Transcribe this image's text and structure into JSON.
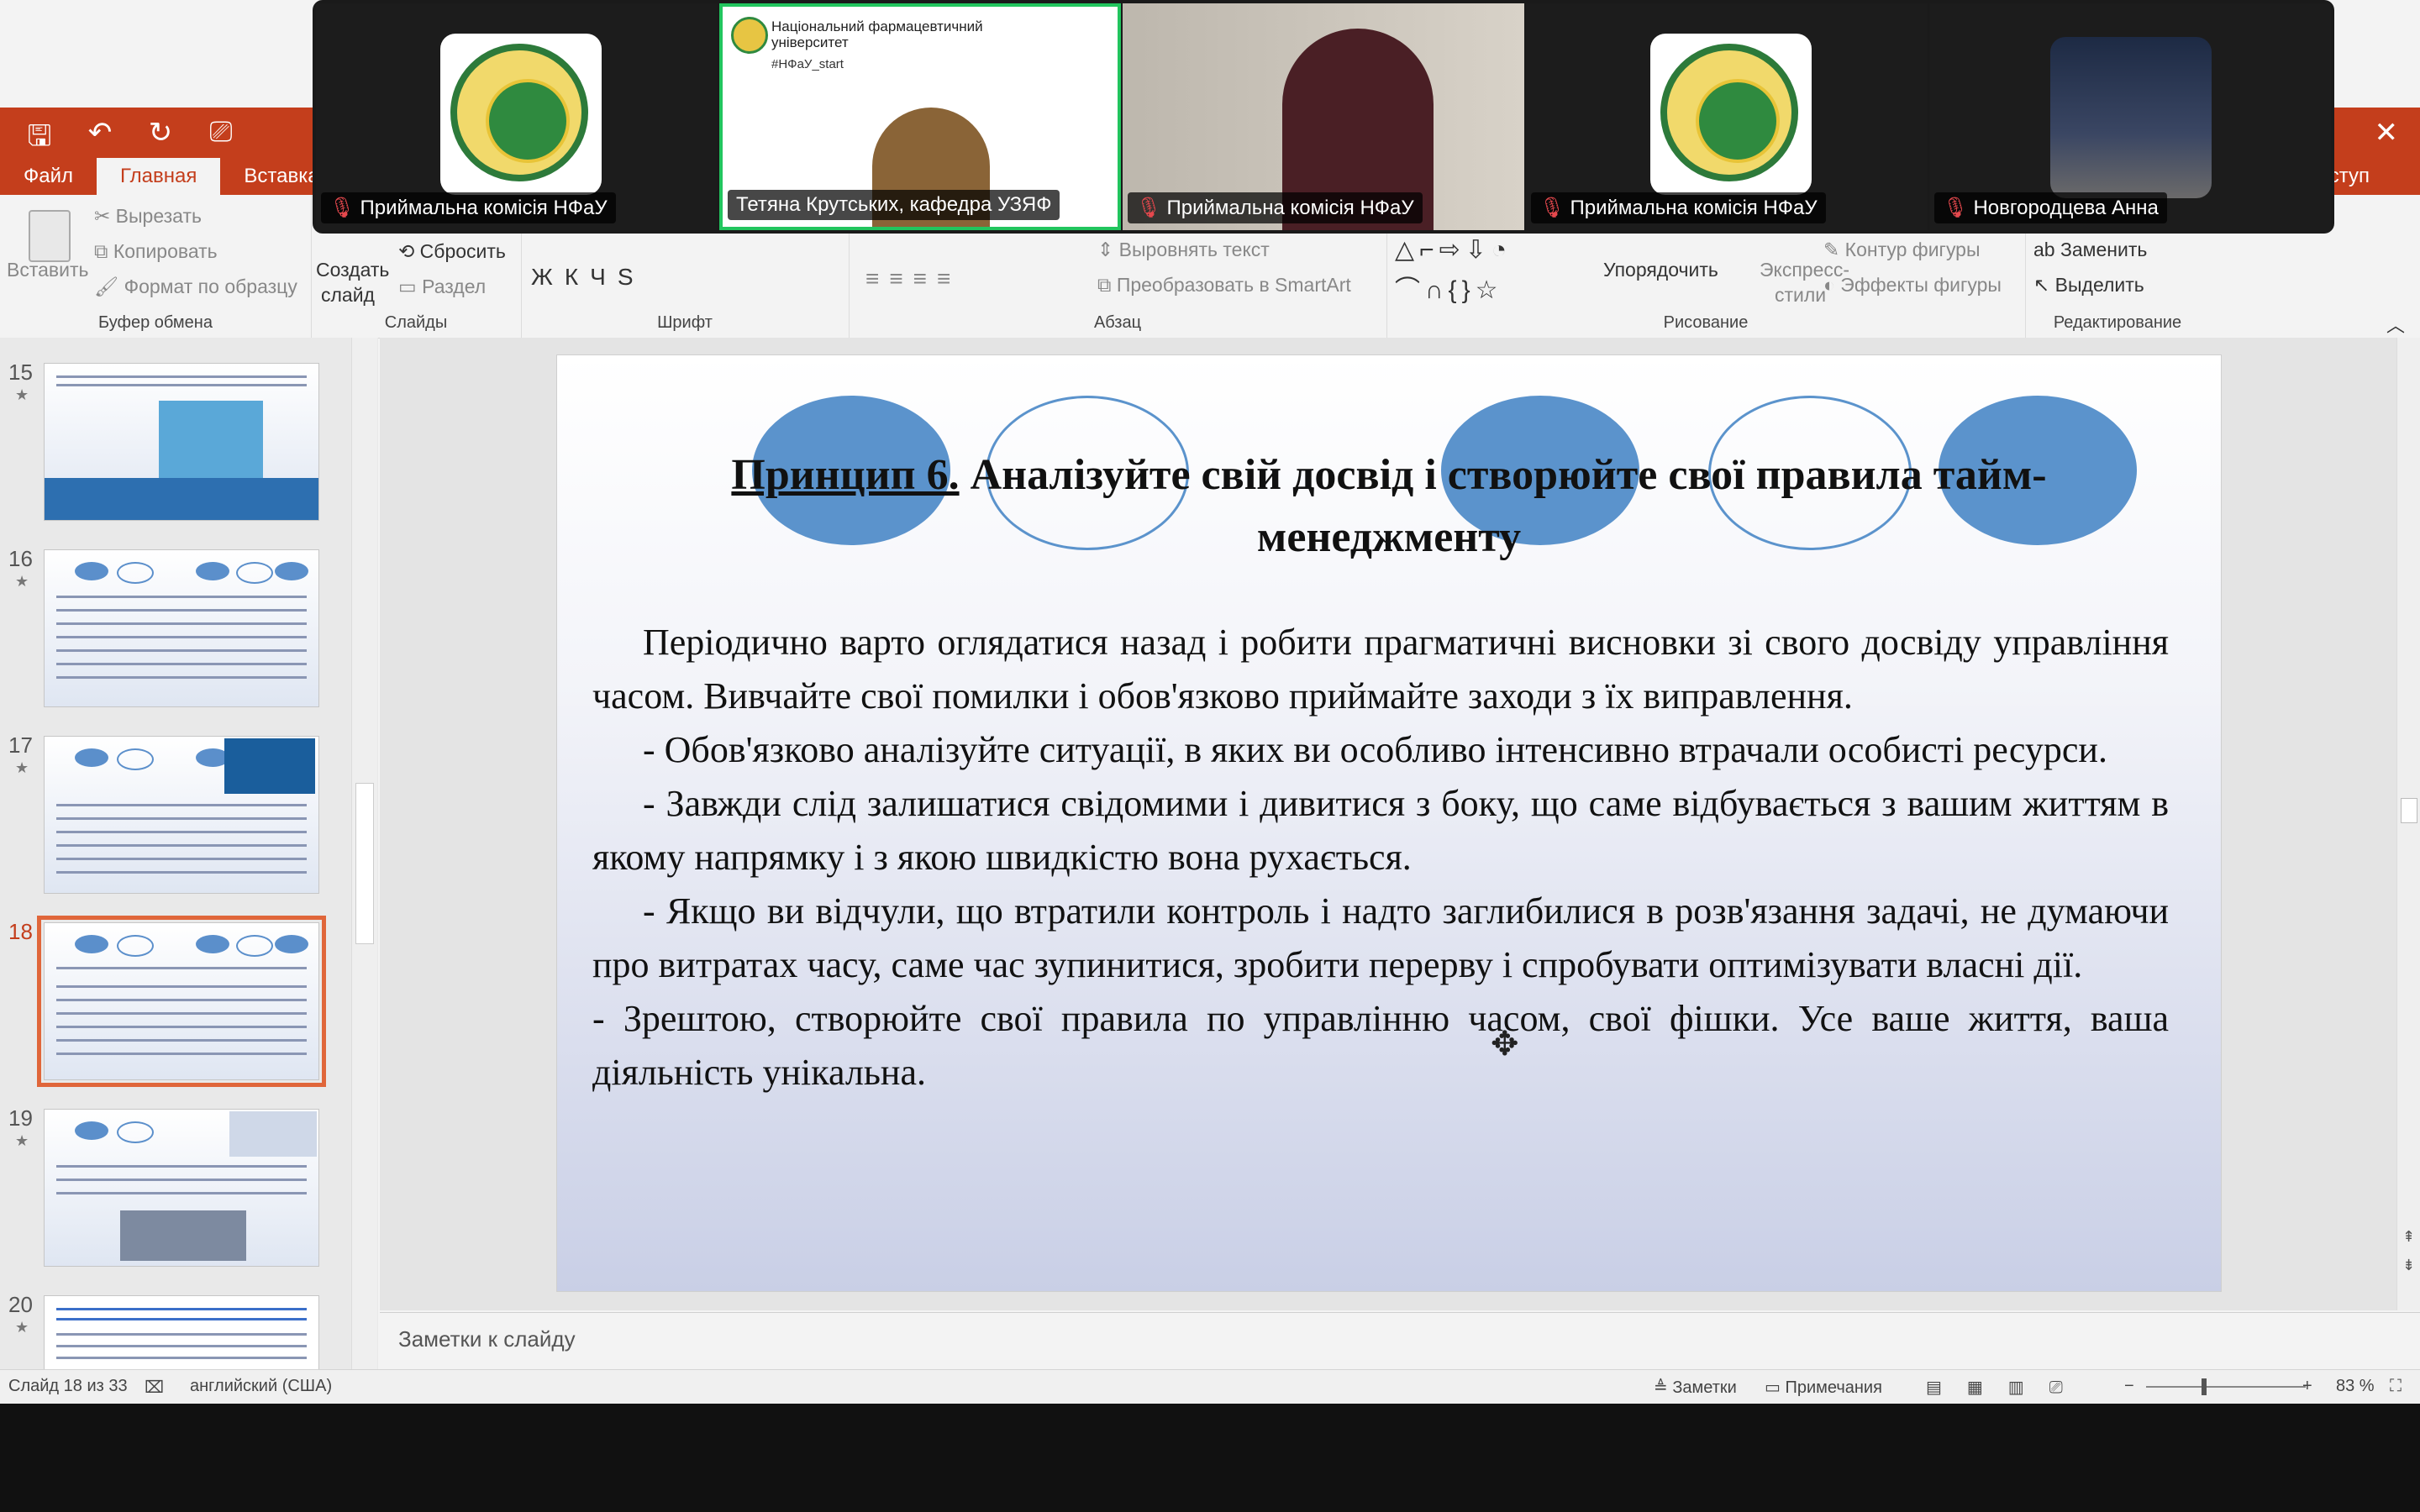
{
  "ribbon": {
    "tabs": [
      "Файл",
      "Главная",
      "Вставка"
    ],
    "active_tab": "Главная",
    "share_label": "доступ",
    "clipboard": {
      "paste": "Вставить",
      "cut": "Вырезать",
      "copy": "Копировать",
      "format_painter": "Формат по образцу",
      "group_label": "Буфер обмена"
    },
    "slides": {
      "new_slide": "Создать",
      "new_slide_2": "слайд",
      "reset": "Сбросить",
      "section": "Раздел",
      "group_label": "Слайды"
    },
    "font": {
      "group_label": "Шрифт"
    },
    "paragraph": {
      "align_text": "Выровнять текст",
      "convert_smartart": "Преобразовать в SmartArt",
      "group_label": "Абзац"
    },
    "drawing": {
      "arrange": "Упорядочить",
      "quick_styles": "Экспресс-",
      "quick_styles_2": "стили",
      "shape_outline": "Контур фигуры",
      "shape_effects": "Эффекты фигуры",
      "group_label": "Рисование"
    },
    "editing": {
      "replace": "Заменить",
      "select": "Выделить",
      "group_label": "Редактирование"
    }
  },
  "thumbnails": [
    {
      "num": "15"
    },
    {
      "num": "16"
    },
    {
      "num": "17"
    },
    {
      "num": "18"
    },
    {
      "num": "19"
    },
    {
      "num": "20"
    }
  ],
  "slide": {
    "title_underlined": "Принцип 6.",
    "title_rest": " Аналізуйте свій досвід і створюйте свої правила тайм-менеджменту",
    "paragraphs": [
      "Періодично варто оглядатися назад і робити прагматичні висновки зі свого досвіду управління часом. Вивчайте свої помилки і обов'язково приймайте заходи з їх виправлення.",
      "- Обов'язково аналізуйте ситуації, в яких ви особливо інтенсивно втрачали особисті ресурси.",
      "- Завжди слід залишатися свідомими і дивитися з боку, що саме відбувається з вашим життям   в якому напрямку і з якою швидкістю вона рухається.",
      "- Якщо ви відчули, що втратили контроль і надто заглибилися в розв'язання задачі, не думаючи про витратах часу, саме час зупинитися, зробити перерву і спробувати оптимізувати власні дії.",
      "-   Зрештою, створюйте свої правила по управлінню часом, свої фішки. Усе ваше життя, ваша діяльність унікальна."
    ]
  },
  "notes_placeholder": "Заметки к слайду",
  "status": {
    "slide_count": "Слайд 18 из 33",
    "language": "английский (США)",
    "notes": "Заметки",
    "comments": "Примечания",
    "zoom": "83 %"
  },
  "video_tiles": [
    {
      "name": "Приймальна комісія НФаУ"
    },
    {
      "name": "Тетяна Крутських, кафедра УЗЯФ",
      "header_1": "Національний фармацевтичний",
      "header_2": "університет",
      "hashtag": "#НФаУ_start"
    },
    {
      "name": "Приймальна комісія НФаУ"
    },
    {
      "name": "Приймальна комісія НФаУ"
    },
    {
      "name": "Новгородцева Анна"
    }
  ],
  "colors": {
    "accent": "#c43e1c",
    "oval": "#5b93cc",
    "active_speaker": "#22c55e"
  }
}
